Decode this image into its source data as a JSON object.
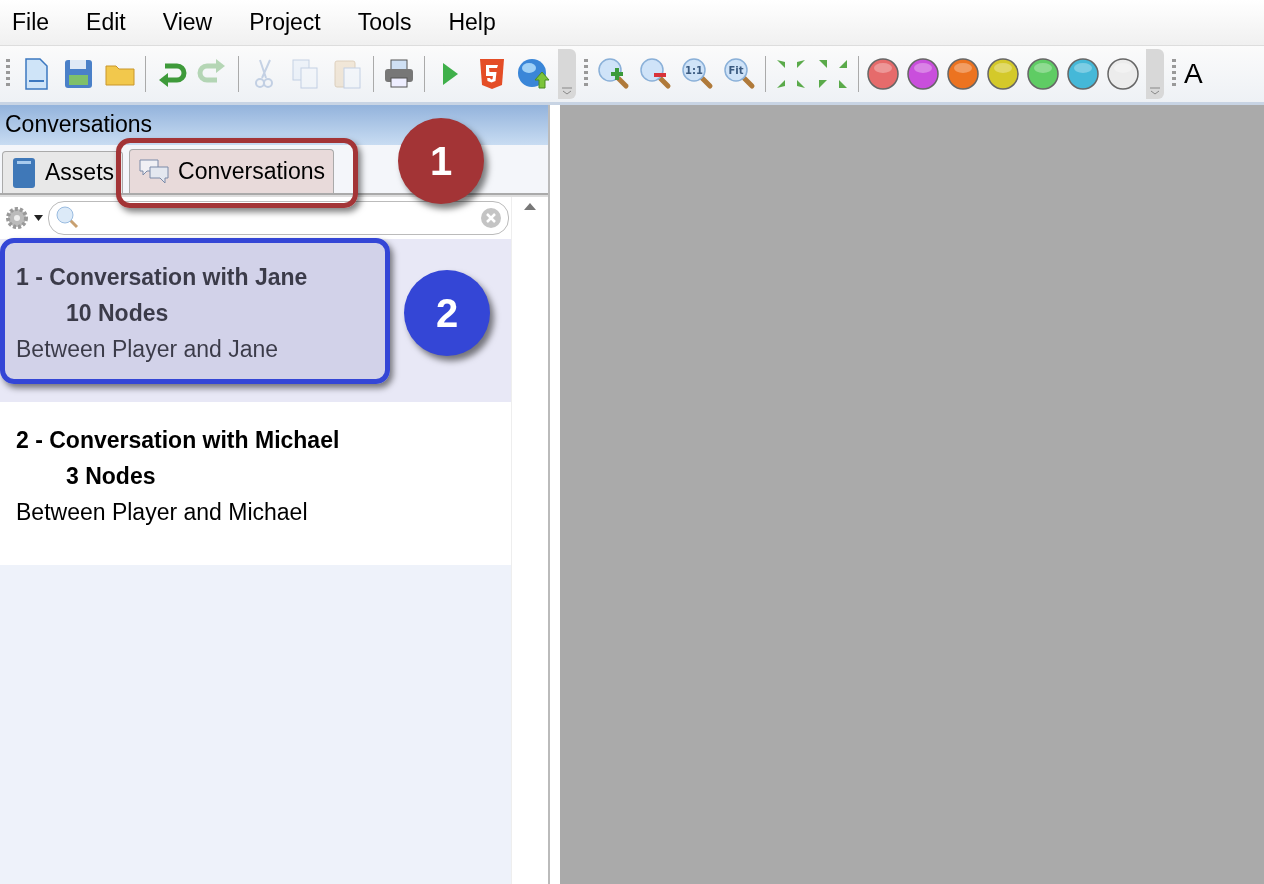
{
  "menu": [
    "File",
    "Edit",
    "View",
    "Project",
    "Tools",
    "Help"
  ],
  "toolbar": [
    {
      "kind": "new",
      "disabled": false
    },
    {
      "kind": "save",
      "disabled": false
    },
    {
      "kind": "open",
      "disabled": false
    },
    {
      "kind": "sep"
    },
    {
      "kind": "undo",
      "disabled": false
    },
    {
      "kind": "redo",
      "disabled": true
    },
    {
      "kind": "sep"
    },
    {
      "kind": "cut",
      "disabled": true
    },
    {
      "kind": "copy",
      "disabled": true
    },
    {
      "kind": "paste",
      "disabled": true
    },
    {
      "kind": "sep"
    },
    {
      "kind": "print",
      "disabled": false
    },
    {
      "kind": "sep"
    },
    {
      "kind": "play",
      "disabled": false
    },
    {
      "kind": "html5",
      "disabled": false
    },
    {
      "kind": "publish",
      "disabled": false
    },
    {
      "kind": "overflow"
    },
    {
      "kind": "grip"
    },
    {
      "kind": "zoom-in",
      "disabled": false
    },
    {
      "kind": "zoom-out",
      "disabled": false
    },
    {
      "kind": "zoom-actual",
      "label": "1:1",
      "disabled": false
    },
    {
      "kind": "zoom-fit",
      "label": "Fit",
      "disabled": false
    },
    {
      "kind": "sep"
    },
    {
      "kind": "collapse",
      "disabled": false
    },
    {
      "kind": "expand",
      "disabled": false
    },
    {
      "kind": "sep"
    },
    {
      "kind": "color",
      "color": "#e66b6b"
    },
    {
      "kind": "color",
      "color": "#c94fdc"
    },
    {
      "kind": "color",
      "color": "#ec7320"
    },
    {
      "kind": "color",
      "color": "#d4c92a"
    },
    {
      "kind": "color",
      "color": "#5fcc64"
    },
    {
      "kind": "color",
      "color": "#45b8d8"
    },
    {
      "kind": "color",
      "color": "#ececec"
    },
    {
      "kind": "overflow"
    },
    {
      "kind": "grip"
    },
    {
      "kind": "text",
      "label": "A"
    }
  ],
  "panel": {
    "title": "Conversations",
    "tabs": [
      {
        "label": "Assets",
        "kind": "book",
        "selected": false
      },
      {
        "label": "Conversations",
        "kind": "chat",
        "selected": true
      }
    ],
    "conversations": [
      {
        "title": "1 - Conversation with Jane",
        "nodes": "10 Nodes",
        "description": "Between Player and Jane",
        "selected": true
      },
      {
        "title": "2 - Conversation with Michael",
        "nodes": "3 Nodes",
        "description": "Between Player and Michael",
        "selected": false
      }
    ]
  },
  "callouts": [
    {
      "number": "1",
      "color": "#a33436"
    },
    {
      "number": "2",
      "color": "#3446d6"
    }
  ]
}
